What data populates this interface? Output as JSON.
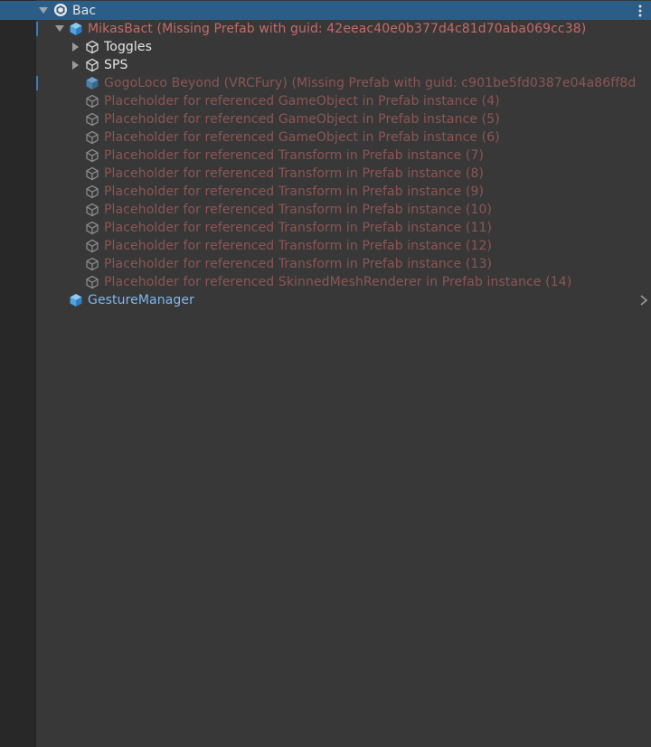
{
  "hierarchy": {
    "root": {
      "label": "Bac",
      "icon": "unity-scene-icon"
    },
    "items": [
      {
        "label": "MikasBact (Missing Prefab with guid: 42eeac40e0b377d4c81d70aba069cc38)",
        "icon": "prefab-cube-icon"
      },
      {
        "label": "Toggles",
        "icon": "gameobject-cube-icon"
      },
      {
        "label": "SPS",
        "icon": "gameobject-cube-icon"
      },
      {
        "label": "GogoLoco Beyond (VRCFury) (Missing Prefab with guid: c901be5fd0387e04a86ff8d",
        "icon": "prefab-cube-icon"
      },
      {
        "label": "Placeholder for referenced GameObject in Prefab instance (4)",
        "icon": "gameobject-cube-icon"
      },
      {
        "label": "Placeholder for referenced GameObject in Prefab instance (5)",
        "icon": "gameobject-cube-icon"
      },
      {
        "label": "Placeholder for referenced GameObject in Prefab instance (6)",
        "icon": "gameobject-cube-icon"
      },
      {
        "label": "Placeholder for referenced Transform in Prefab instance (7)",
        "icon": "gameobject-cube-icon"
      },
      {
        "label": "Placeholder for referenced Transform in Prefab instance (8)",
        "icon": "gameobject-cube-icon"
      },
      {
        "label": "Placeholder for referenced Transform in Prefab instance (9)",
        "icon": "gameobject-cube-icon"
      },
      {
        "label": "Placeholder for referenced Transform in Prefab instance (10)",
        "icon": "gameobject-cube-icon"
      },
      {
        "label": "Placeholder for referenced Transform in Prefab instance (11)",
        "icon": "gameobject-cube-icon"
      },
      {
        "label": "Placeholder for referenced Transform in Prefab instance (12)",
        "icon": "gameobject-cube-icon"
      },
      {
        "label": "Placeholder for referenced Transform in Prefab instance (13)",
        "icon": "gameobject-cube-icon"
      },
      {
        "label": "Placeholder for referenced SkinnedMeshRenderer in Prefab instance (14)",
        "icon": "gameobject-cube-icon"
      },
      {
        "label": "GestureManager",
        "icon": "prefab-cube-icon"
      }
    ]
  },
  "colors": {
    "selection": "#2c5d87",
    "missing_prefab": "#c46a6a",
    "prefab": "#7fb7ef",
    "text": "#e6e6e6"
  }
}
